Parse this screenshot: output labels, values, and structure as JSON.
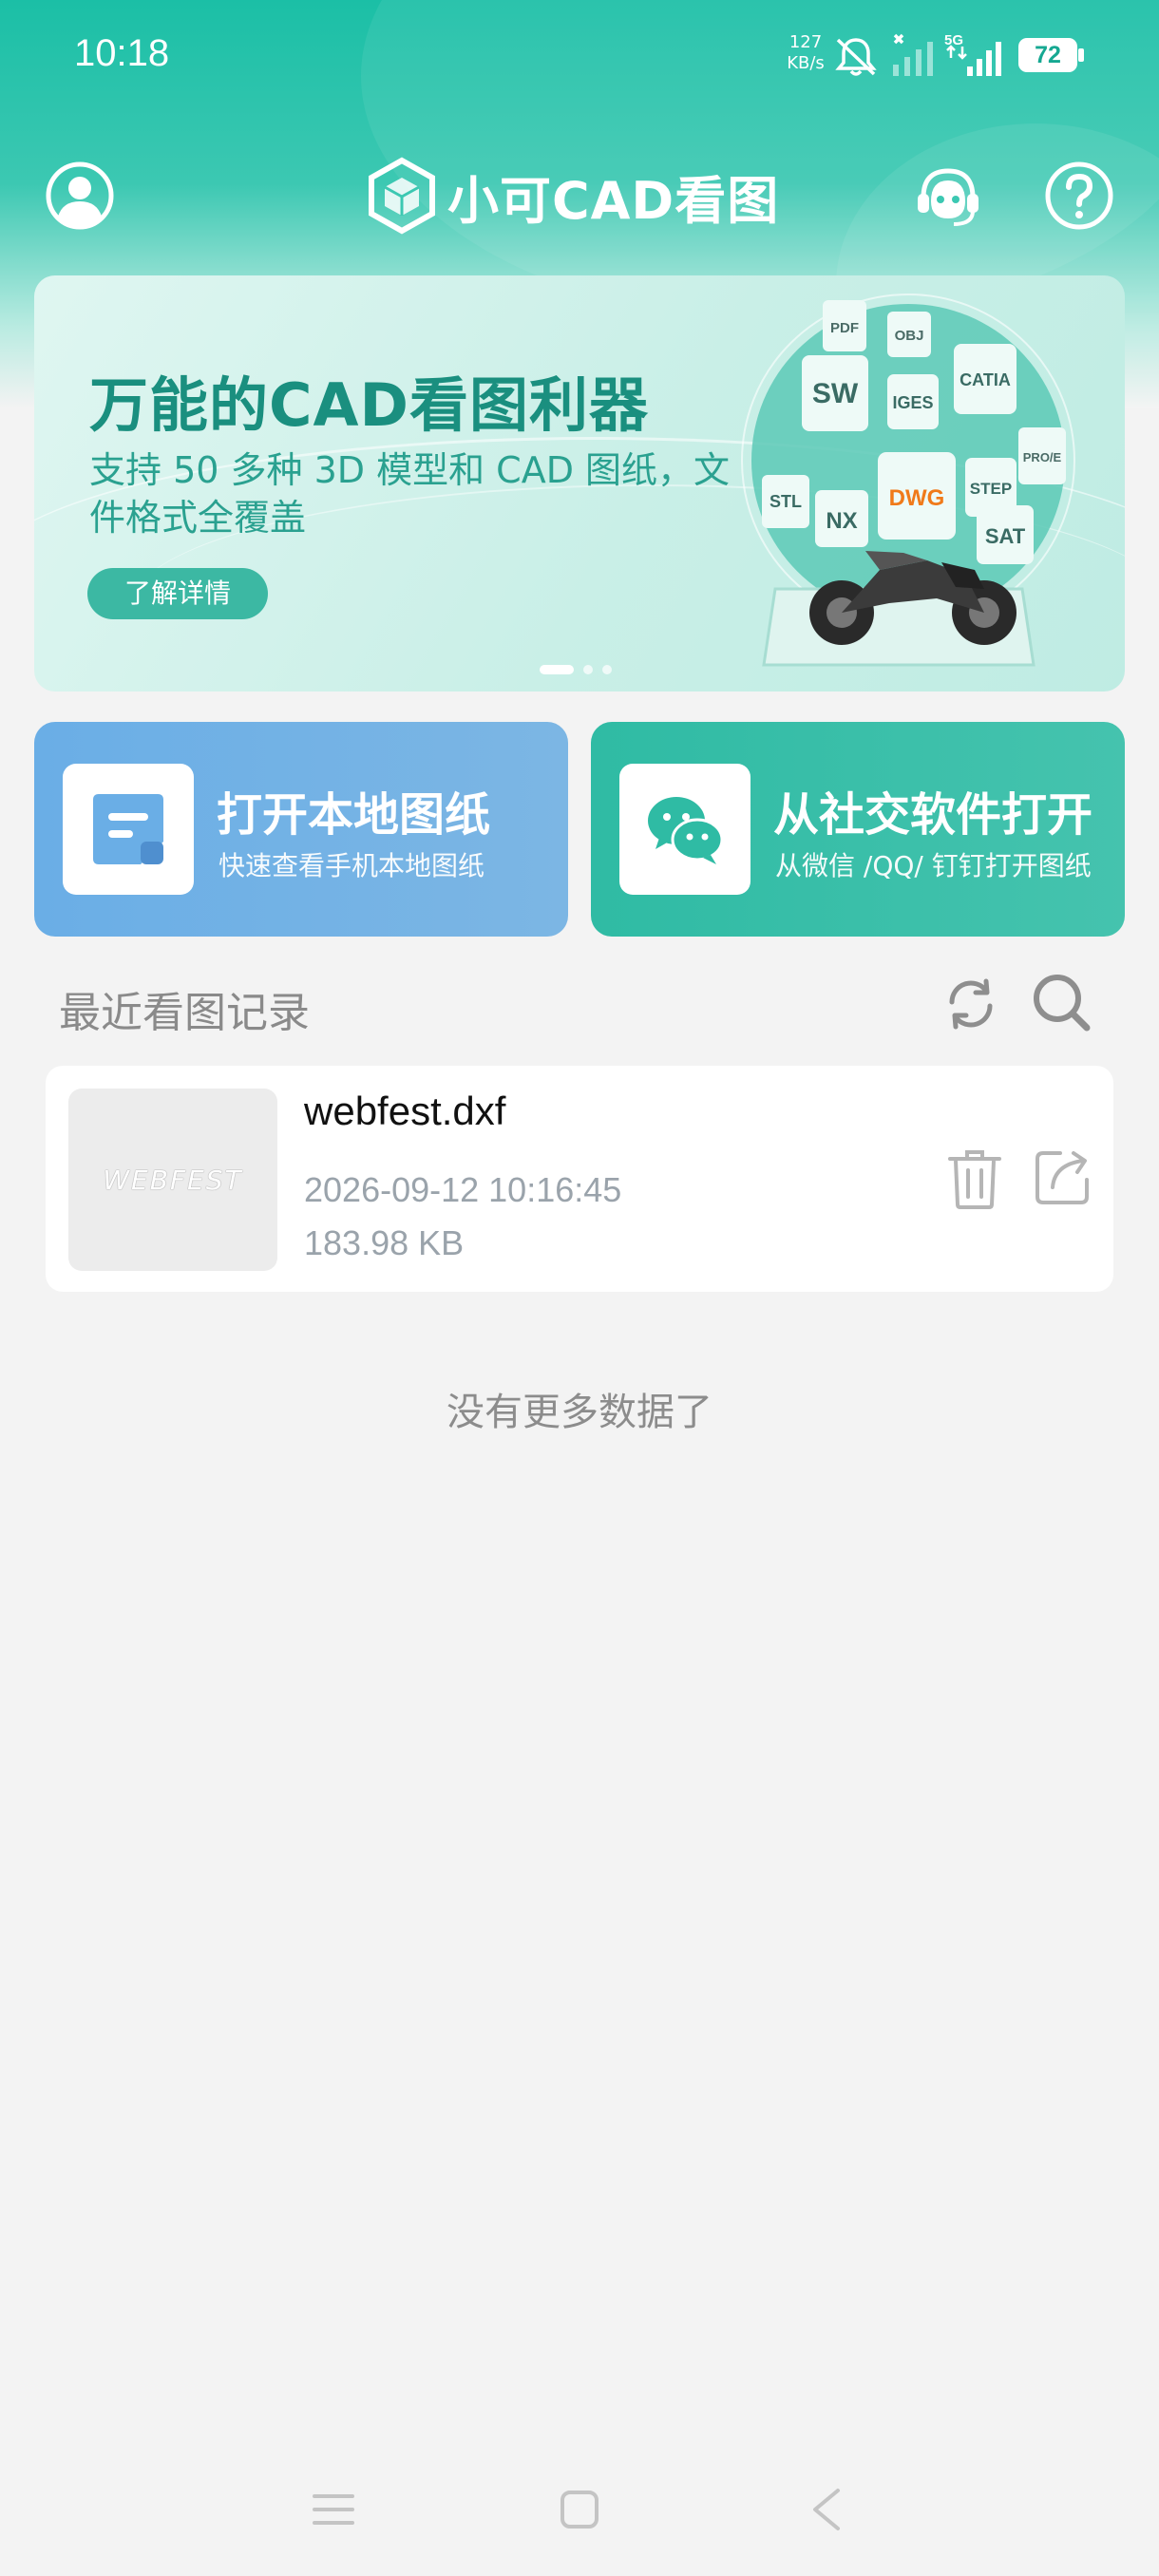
{
  "status_bar": {
    "time": "10:18",
    "net_speed_value": "127",
    "net_speed_unit": "KB/s",
    "network_type": "5G",
    "battery": "72"
  },
  "header": {
    "app_title": "小可CAD看图"
  },
  "banner": {
    "title": "万能的CAD看图利器",
    "subtitle": "支持 50 多种 3D 模型和 CAD 图纸，文件格式全覆盖",
    "button_label": "了解详情",
    "format_tags": [
      "PDF",
      "OBJ",
      "SW",
      "IGES",
      "CATIA",
      "PRO/E",
      "STL",
      "NX",
      "DWG",
      "STEP",
      "SAT"
    ],
    "active_slide": 1,
    "slide_count": 3
  },
  "actions": {
    "local": {
      "title": "打开本地图纸",
      "subtitle": "快速查看手机本地图纸"
    },
    "social": {
      "title": "从社交软件打开",
      "subtitle": "从微信 /QQ/ 钉钉打开图纸"
    }
  },
  "recent": {
    "title": "最近看图记录",
    "files": [
      {
        "name": "webfest.dxf",
        "thumbnail_text": "WEBFEST",
        "modified": "2026-09-12 10:16:45",
        "size": "183.98 KB"
      }
    ],
    "empty_hint": "没有更多数据了"
  },
  "colors": {
    "brand_teal": "#1bbfa6",
    "local_card_blue": "#6aaee6",
    "social_card_teal": "#2fbba4",
    "dwg_orange": "#f07a1a"
  }
}
